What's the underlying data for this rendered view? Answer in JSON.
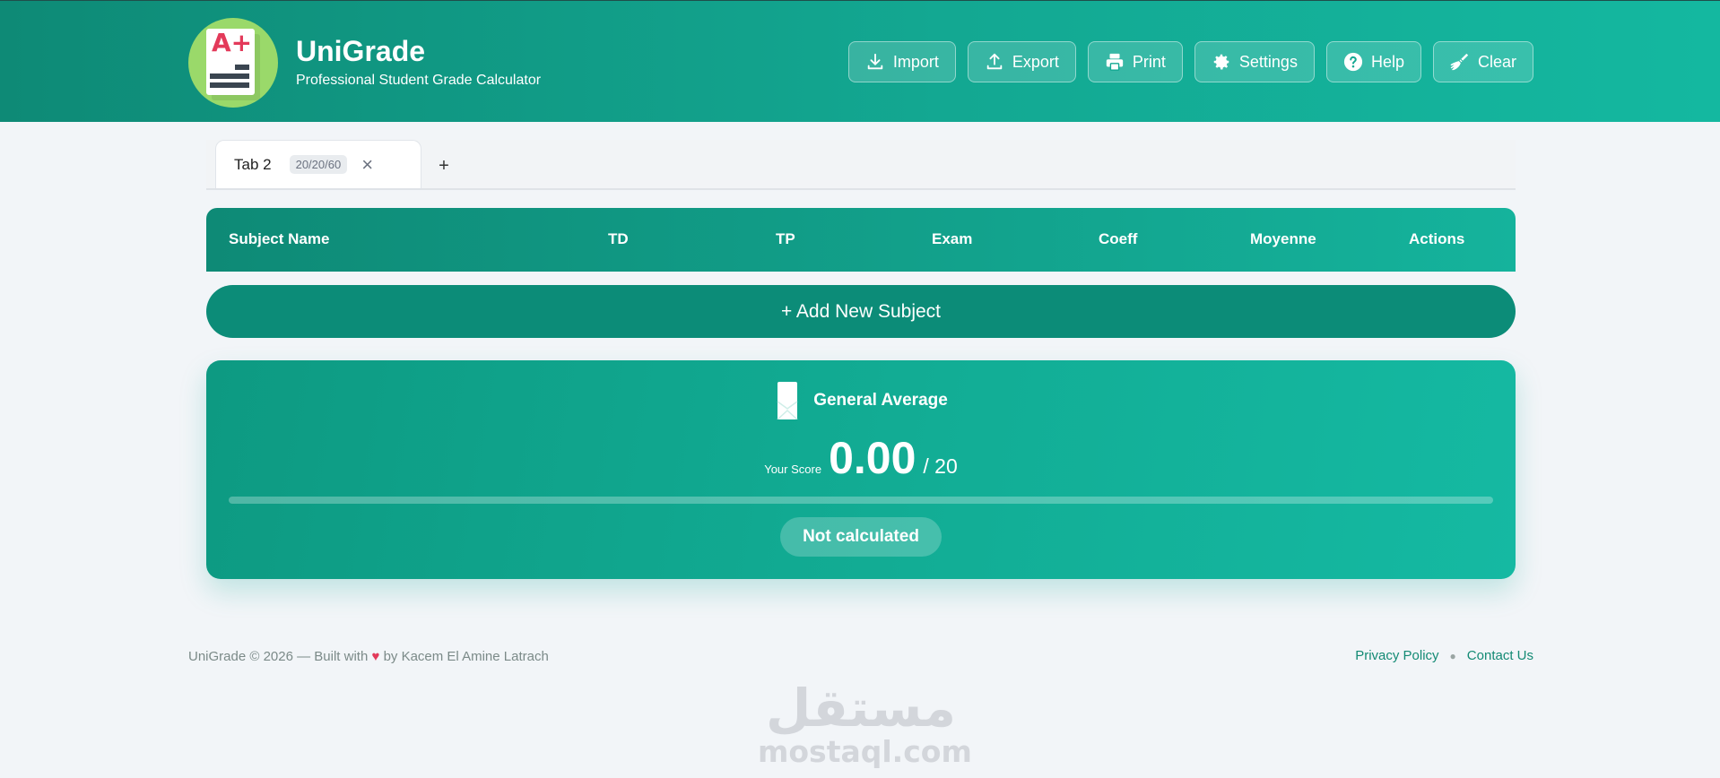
{
  "brand": {
    "title": "UniGrade",
    "subtitle": "Professional Student Grade Calculator",
    "logo_text": "A+"
  },
  "toolbar": {
    "import_label": "Import",
    "export_label": "Export",
    "print_label": "Print",
    "settings_label": "Settings",
    "help_label": "Help",
    "clear_label": "Clear"
  },
  "tabs": [
    {
      "label": "Tab 2",
      "badge": "20/20/60"
    }
  ],
  "tab_add_label": "+",
  "table": {
    "columns": [
      "Subject Name",
      "TD",
      "TP",
      "Exam",
      "Coeff",
      "Moyenne",
      "Actions"
    ],
    "rows": []
  },
  "add_subject_label": "+ Add New Subject",
  "average": {
    "title": "General Average",
    "score_label": "Your Score",
    "score": "0.00",
    "max": "/ 20",
    "progress_percent": 0,
    "status": "Not calculated"
  },
  "footer": {
    "copyright_before": "UniGrade © 2026 — Built with",
    "copyright_after": "by Kacem El Amine Latrach",
    "links": [
      "Privacy Policy",
      "Contact Us"
    ]
  },
  "watermark": {
    "arabic": "مستقل",
    "latin": "mostaql.com"
  },
  "colors": {
    "primary": "#0e8a76",
    "accent": "#14b8a0",
    "heart": "#e23a5a",
    "link": "#138a74"
  }
}
